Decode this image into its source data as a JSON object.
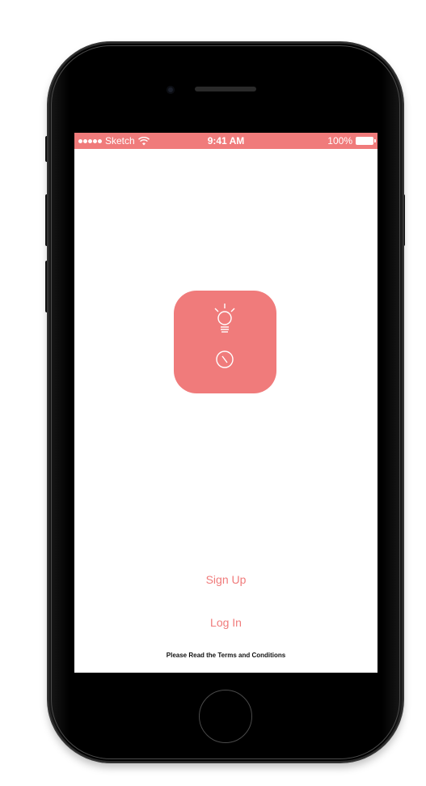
{
  "status_bar": {
    "carrier": "Sketch",
    "time": "9:41 AM",
    "battery": "100%",
    "color": "#f07b7b"
  },
  "app_icon": {
    "icons": [
      "lightbulb-icon",
      "clock-icon"
    ],
    "color": "#f07b7b"
  },
  "actions": {
    "sign_up_label": "Sign Up",
    "log_in_label": "Log In",
    "terms_label": "Please Read the Terms and Conditions"
  },
  "colors": {
    "accent": "#f07b7b",
    "screen_bg": "#ffffff",
    "device": "#000000"
  }
}
